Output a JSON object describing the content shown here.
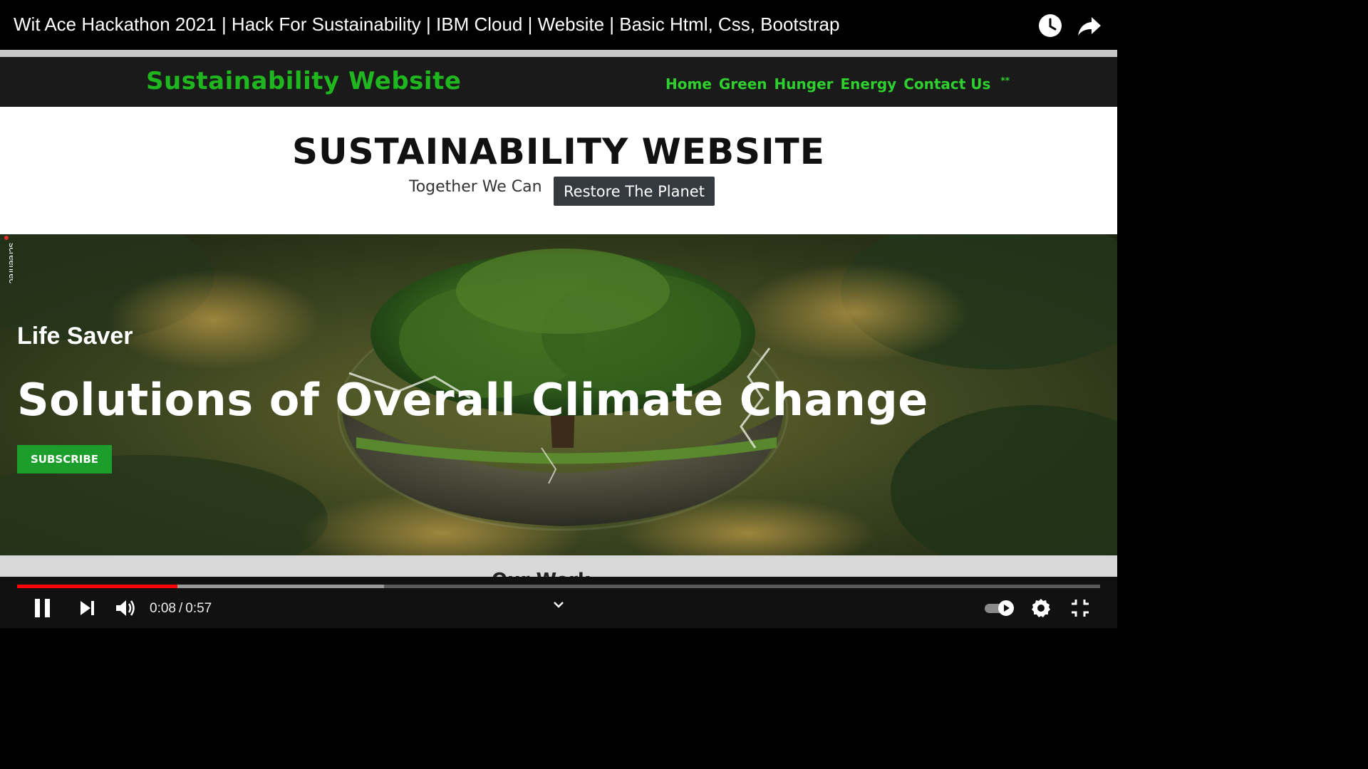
{
  "player": {
    "video_title": "Wit Ace Hackathon 2021 | Hack For Sustainability | IBM Cloud | Website | Basic Html, Css, Bootstrap",
    "current_time": "0:08",
    "separator": "/",
    "duration": "0:57",
    "progress_played": 0.148,
    "progress_buffered": 0.339,
    "icons": [
      "watch-later-icon",
      "share-icon",
      "pause-icon",
      "next-icon",
      "volume-icon",
      "chevron-down-icon",
      "autoplay-toggle-icon",
      "settings-icon",
      "exit-fullscreen-icon"
    ],
    "accent_color": "#ff0000"
  },
  "site": {
    "brand": "Sustainability Website",
    "nav": [
      "Home",
      "Green",
      "Hunger",
      "Energy",
      "Contact Us"
    ],
    "hero_title": "SUSTAINABILITY WEBSITE",
    "tagline": "Together We Can",
    "restore_button": "Restore The Planet",
    "banner_kicker": "Life Saver",
    "banner_heading": "Solutions of Overall Climate Change",
    "subscribe_button": "SUBSCRIBE",
    "peek_heading": "Our Work",
    "watermark": "screenrec",
    "brand_color": "#1fb61f"
  }
}
